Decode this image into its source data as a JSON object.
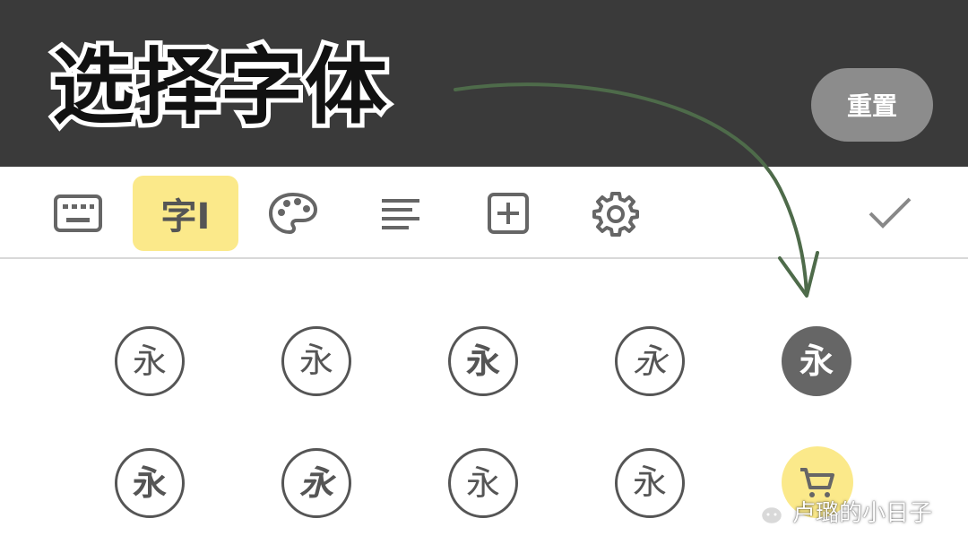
{
  "header": {
    "title": "选择字体",
    "reset_label": "重置"
  },
  "toolbar": {
    "font_tab_label": "字I",
    "items": [
      {
        "icon": "keyboard-icon"
      },
      {
        "icon": "font-icon",
        "active": true
      },
      {
        "icon": "palette-icon"
      },
      {
        "icon": "align-left-icon"
      },
      {
        "icon": "add-box-icon"
      },
      {
        "icon": "gear-icon"
      },
      {
        "icon": "check-icon"
      }
    ]
  },
  "fonts": {
    "row1": [
      "永",
      "永",
      "永",
      "永",
      "永"
    ],
    "row2": [
      "永",
      "永",
      "永",
      "永"
    ],
    "selected_index": 4
  },
  "watermark": {
    "text": "卢璐的小日子"
  },
  "colors": {
    "header_bg": "#3a3a3a",
    "accent_yellow": "#fbe98a",
    "arrow_green": "#4e6b4a",
    "icon_gray": "#666666"
  }
}
